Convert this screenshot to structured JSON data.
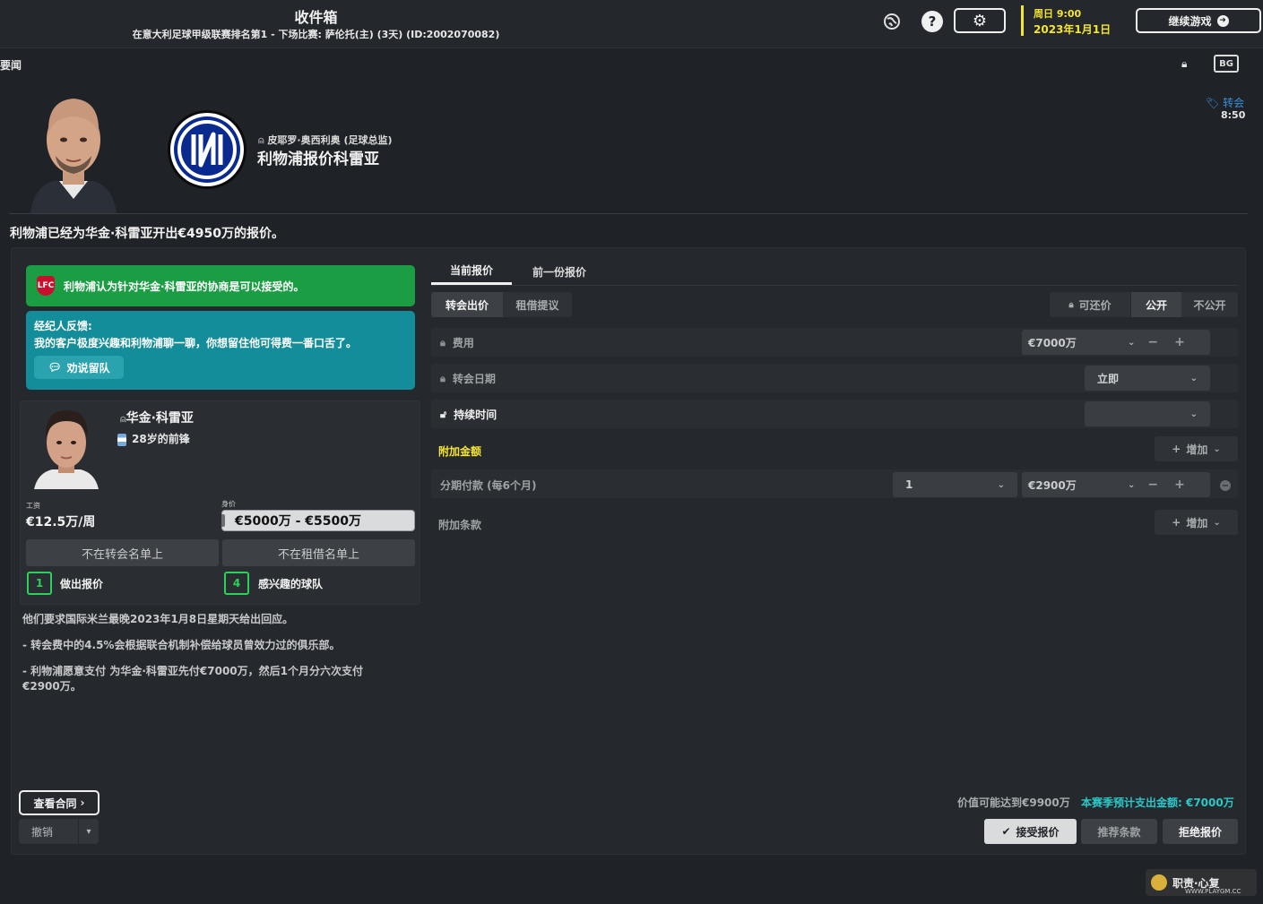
{
  "topbar": {
    "title": "收件箱",
    "subtitle": "在意大利足球甲级联赛排名第1 - 下场比赛: 萨伦托(主) (3天) (ID:2002070082)",
    "help": "?",
    "date_day": "周日 9:00",
    "date_full": "2023年1月1日",
    "continue_label": "继续游戏"
  },
  "subbar": {
    "section": "要闻",
    "fm_label": "BG"
  },
  "message": {
    "sender": "皮耶罗·奥西利奥 (足球总监)",
    "subject": "利物浦报价科雷亚",
    "tag": "转会",
    "time": "8:50",
    "lead": "利物浦已经为华金·科雷亚开出€4950万的报价。"
  },
  "left": {
    "green_banner": "利物浦认为针对华金·科雷亚的协商是可以接受的。",
    "crest_label": "LFC",
    "agent_title": "经纪人反馈:",
    "agent_text": "我的客户极度兴趣和利物浦聊一聊，你想留住他可得费一番口舌了。",
    "persuade_label": "劝说留队",
    "player_name": "华金·科雷亚",
    "player_desc": "28岁的前锋",
    "wage_label": "工资",
    "wage_value": "€12.5万/周",
    "value_label": "身价",
    "value_range": "€5000万 - €5500万",
    "not_transfer": "不在转会名单上",
    "not_loan": "不在租借名单上",
    "offers_count": "1",
    "offers_label": "做出报价",
    "teams_count": "4",
    "teams_label": "感兴趣的球队",
    "note1": "他们要求国际米兰最晚2023年1月8日星期天给出回应。",
    "note2": "- 转会费中的4.5%会根据联合机制补偿给球员曾效力过的俱乐部。",
    "note3": "- 利物浦愿意支付 为华金·科雷亚先付€7000万，然后1个月分六次支付€2900万。",
    "view_contract": "查看合同",
    "undo": "撤销"
  },
  "right": {
    "tab_current": "当前报价",
    "tab_previous": "前一份报价",
    "seg_transfer": "转会出价",
    "seg_loan": "租借提议",
    "seg_negotiable": "可还价",
    "seg_public": "公开",
    "seg_private": "不公开",
    "fee_label": "费用",
    "fee_value": "€7000万",
    "date_label": "转会日期",
    "date_value": "立即",
    "duration_label": "持续时间",
    "extras_label": "附加金额",
    "add_label": "增加",
    "install_label": "分期付款 (每6个月)",
    "install_count": "1",
    "install_amount": "€2900万",
    "clauses_label": "附加条款",
    "value_reach": "价值可能达到€9900万",
    "season_spend": "本赛季预计支出金额: €7000万",
    "accept": "接受报价",
    "recommend": "推荐条款",
    "reject": "拒绝报价"
  },
  "watermark": {
    "text": "职责·心复",
    "sub": "WWW.PLAYGM.CC"
  },
  "colors": {
    "accent_yellow": "#f5e533",
    "green_banner": "#1a9d43",
    "teal_box": "#138d9a",
    "count_green": "#2ad15a",
    "spend_cyan": "#2bc8c8",
    "inter_blue": "#0a2a8f"
  }
}
